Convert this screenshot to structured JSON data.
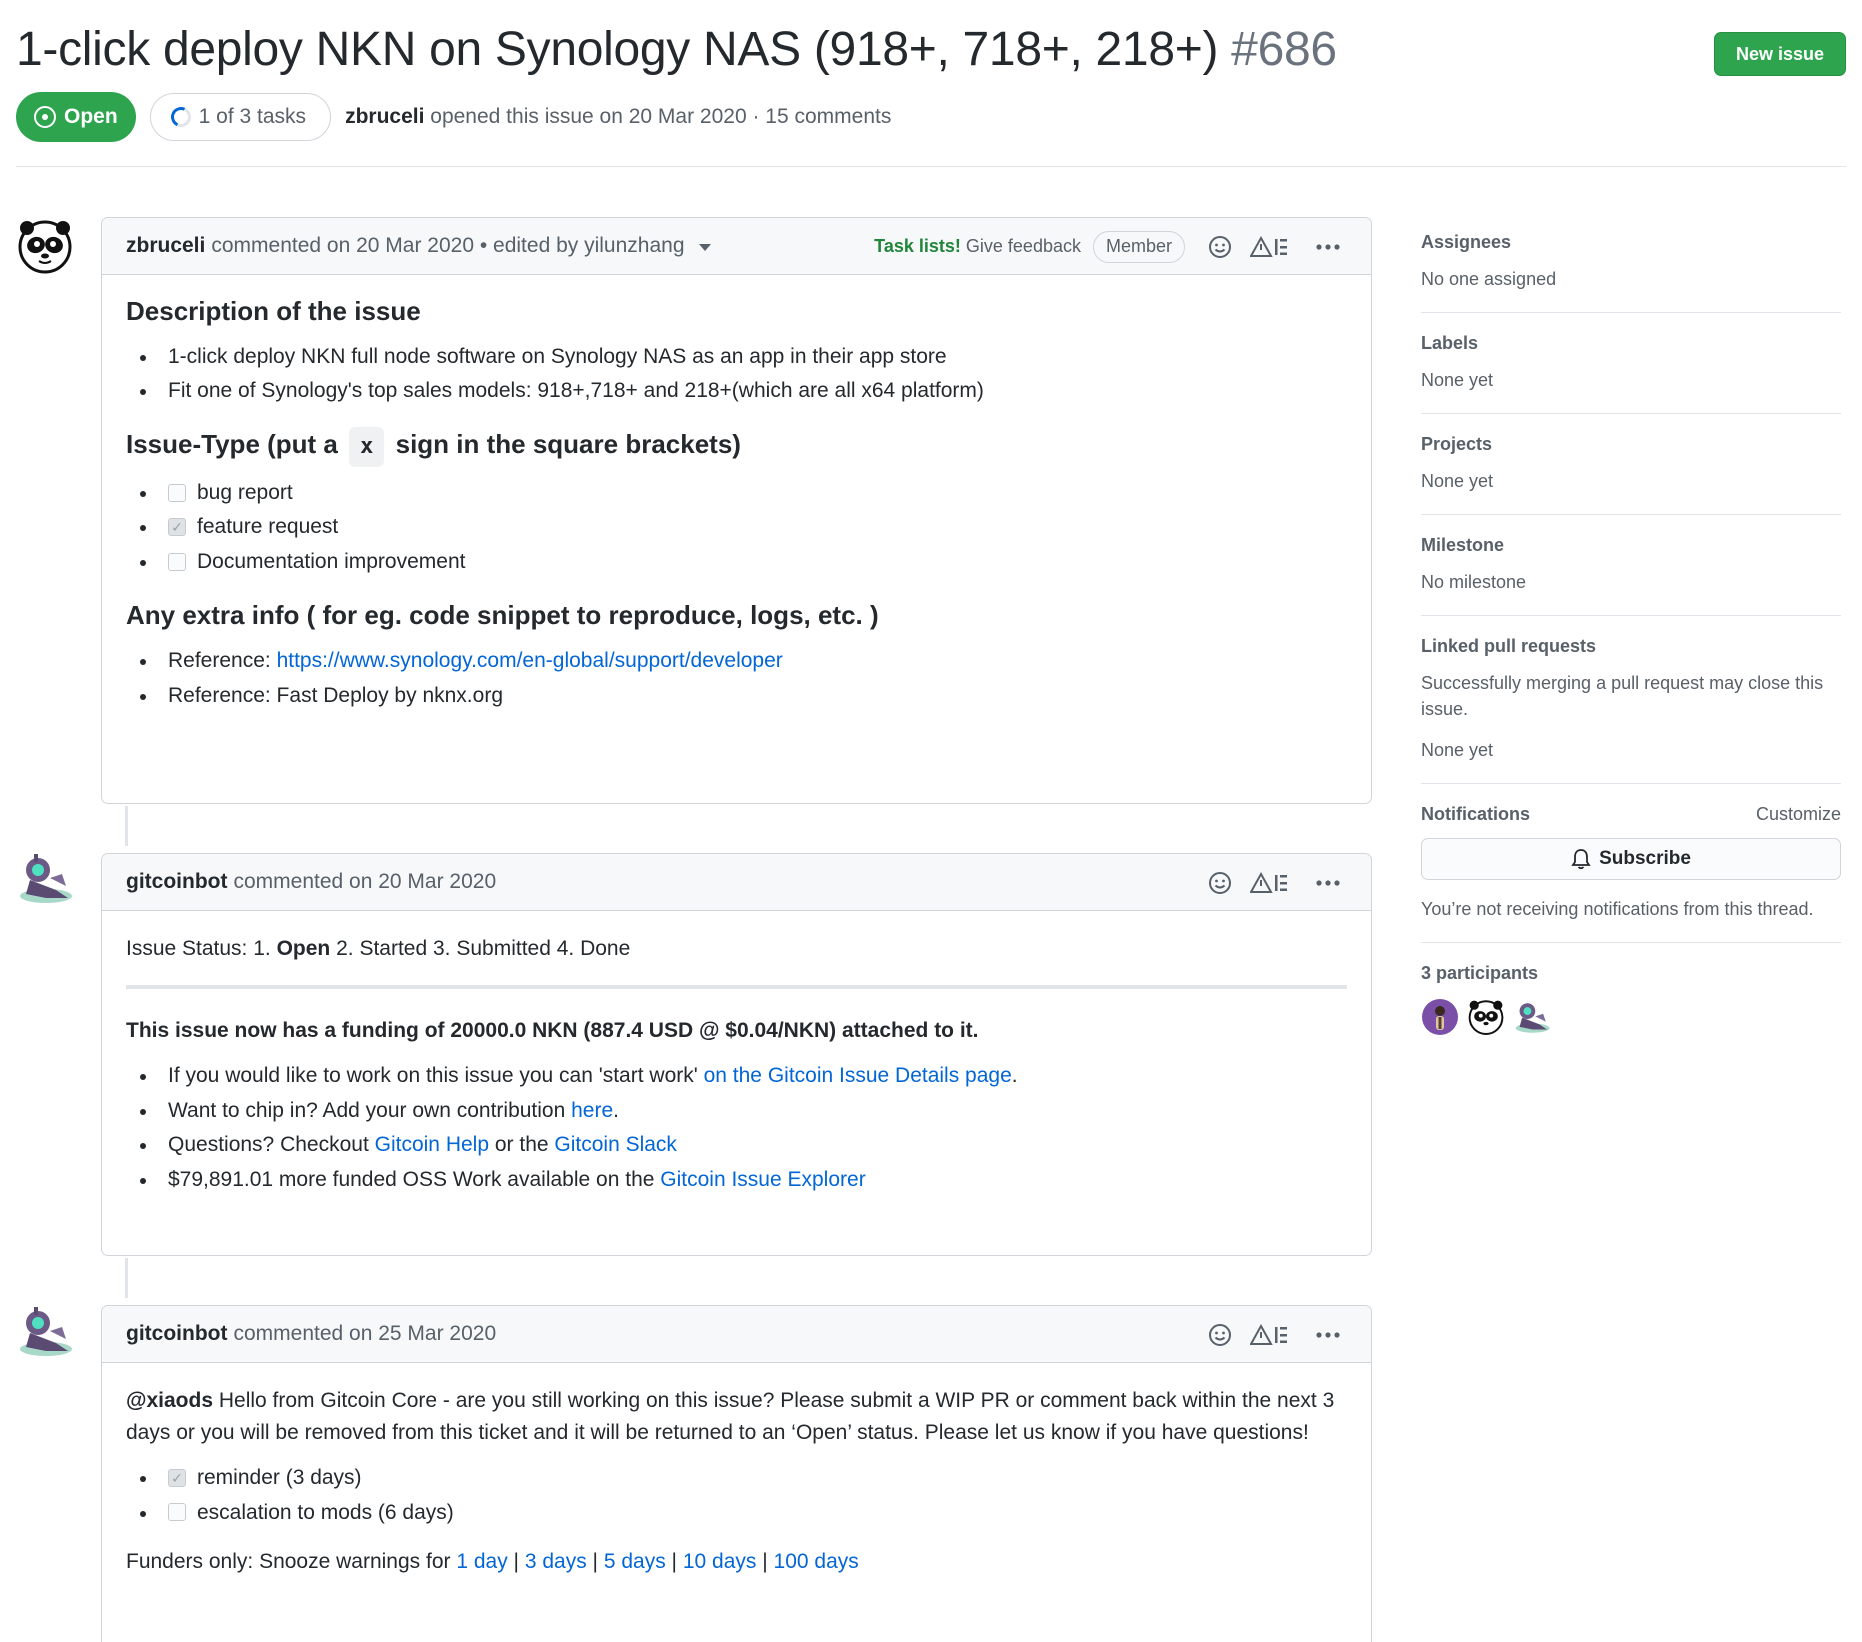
{
  "issue": {
    "title": "1-click deploy NKN on Synology NAS (918+, 718+, 218+)",
    "number": "#686",
    "new_issue_label": "New issue",
    "state": "Open",
    "tasks": "1 of 3 tasks",
    "author": "zbruceli",
    "opened_text": "opened this issue on 20 Mar 2020 · 15 comments"
  },
  "comments": [
    {
      "author": "zbruceli",
      "meta": "commented on 20 Mar 2020 • edited by yilunzhang",
      "task_lists": "Task lists!",
      "give_feedback": "Give feedback",
      "badge": "Member",
      "body": {
        "h_description": "Description of the issue",
        "desc_items": [
          "1-click deploy NKN full node software on Synology NAS as an app in their app store",
          "Fit one of Synology's top sales models: 918+,718+ and 218+(which are all x64 platform)"
        ],
        "h_issue_type_pre": "Issue-Type (put a",
        "h_issue_type_code": "x",
        "h_issue_type_post": "sign in the square brackets)",
        "tasks": [
          {
            "label": "bug report",
            "checked": false
          },
          {
            "label": "feature request",
            "checked": true
          },
          {
            "label": "Documentation improvement",
            "checked": false
          }
        ],
        "h_extra": "Any extra info ( for eg. code snippet to reproduce, logs, etc. )",
        "ref1_prefix": "Reference: ",
        "ref1_link": "https://www.synology.com/en-global/support/developer",
        "ref2": "Reference: Fast Deploy by nknx.org"
      }
    },
    {
      "author": "gitcoinbot",
      "meta": "commented on 20 Mar 2020",
      "body": {
        "status_pre": "Issue Status: 1. ",
        "status_open": "Open",
        "status_post": " 2. Started 3. Submitted 4. Done",
        "funding": "This issue now has a funding of 20000.0 NKN (887.4 USD @ $0.04/NKN) attached to it.",
        "i1_pre": "If you would like to work on this issue you can 'start work' ",
        "i1_link": "on the Gitcoin Issue Details page",
        "i1_post": ".",
        "i2_pre": "Want to chip in? Add your own contribution ",
        "i2_link": "here",
        "i2_post": ".",
        "i3_pre": "Questions? Checkout ",
        "i3_link1": "Gitcoin Help",
        "i3_mid": " or the ",
        "i3_link2": "Gitcoin Slack",
        "i4_pre": "$79,891.01 more funded OSS Work available on the ",
        "i4_link": "Gitcoin Issue Explorer"
      }
    },
    {
      "author": "gitcoinbot",
      "meta": "commented on 25 Mar 2020",
      "body": {
        "mention": "@xiaods",
        "text": " Hello from Gitcoin Core - are you still working on this issue? Please submit a WIP PR or comment back within the next 3 days or you will be removed from this ticket and it will be returned to an ‘Open’ status. Please let us know if you have questions!",
        "tasks": [
          {
            "label": "reminder (3 days)",
            "checked": true
          },
          {
            "label": "escalation to mods (6 days)",
            "checked": false
          }
        ],
        "snooze_pre": "Funders only: Snooze warnings for ",
        "snooze": [
          "1 day",
          "3 days",
          "5 days",
          "10 days",
          "100 days"
        ],
        "sep": " | "
      }
    }
  ],
  "sidebar": {
    "assignees": {
      "title": "Assignees",
      "value": "No one assigned"
    },
    "labels": {
      "title": "Labels",
      "value": "None yet"
    },
    "projects": {
      "title": "Projects",
      "value": "None yet"
    },
    "milestone": {
      "title": "Milestone",
      "value": "No milestone"
    },
    "linked": {
      "title": "Linked pull requests",
      "desc": "Successfully merging a pull request may close this issue.",
      "value": "None yet"
    },
    "notifications": {
      "title": "Notifications",
      "customize": "Customize",
      "subscribe": "Subscribe",
      "note": "You’re not receiving notifications from this thread."
    },
    "participants": {
      "title": "3 participants"
    }
  },
  "colors": {
    "green": "#2ea44f",
    "link": "#0366d6",
    "muted": "#586069"
  }
}
